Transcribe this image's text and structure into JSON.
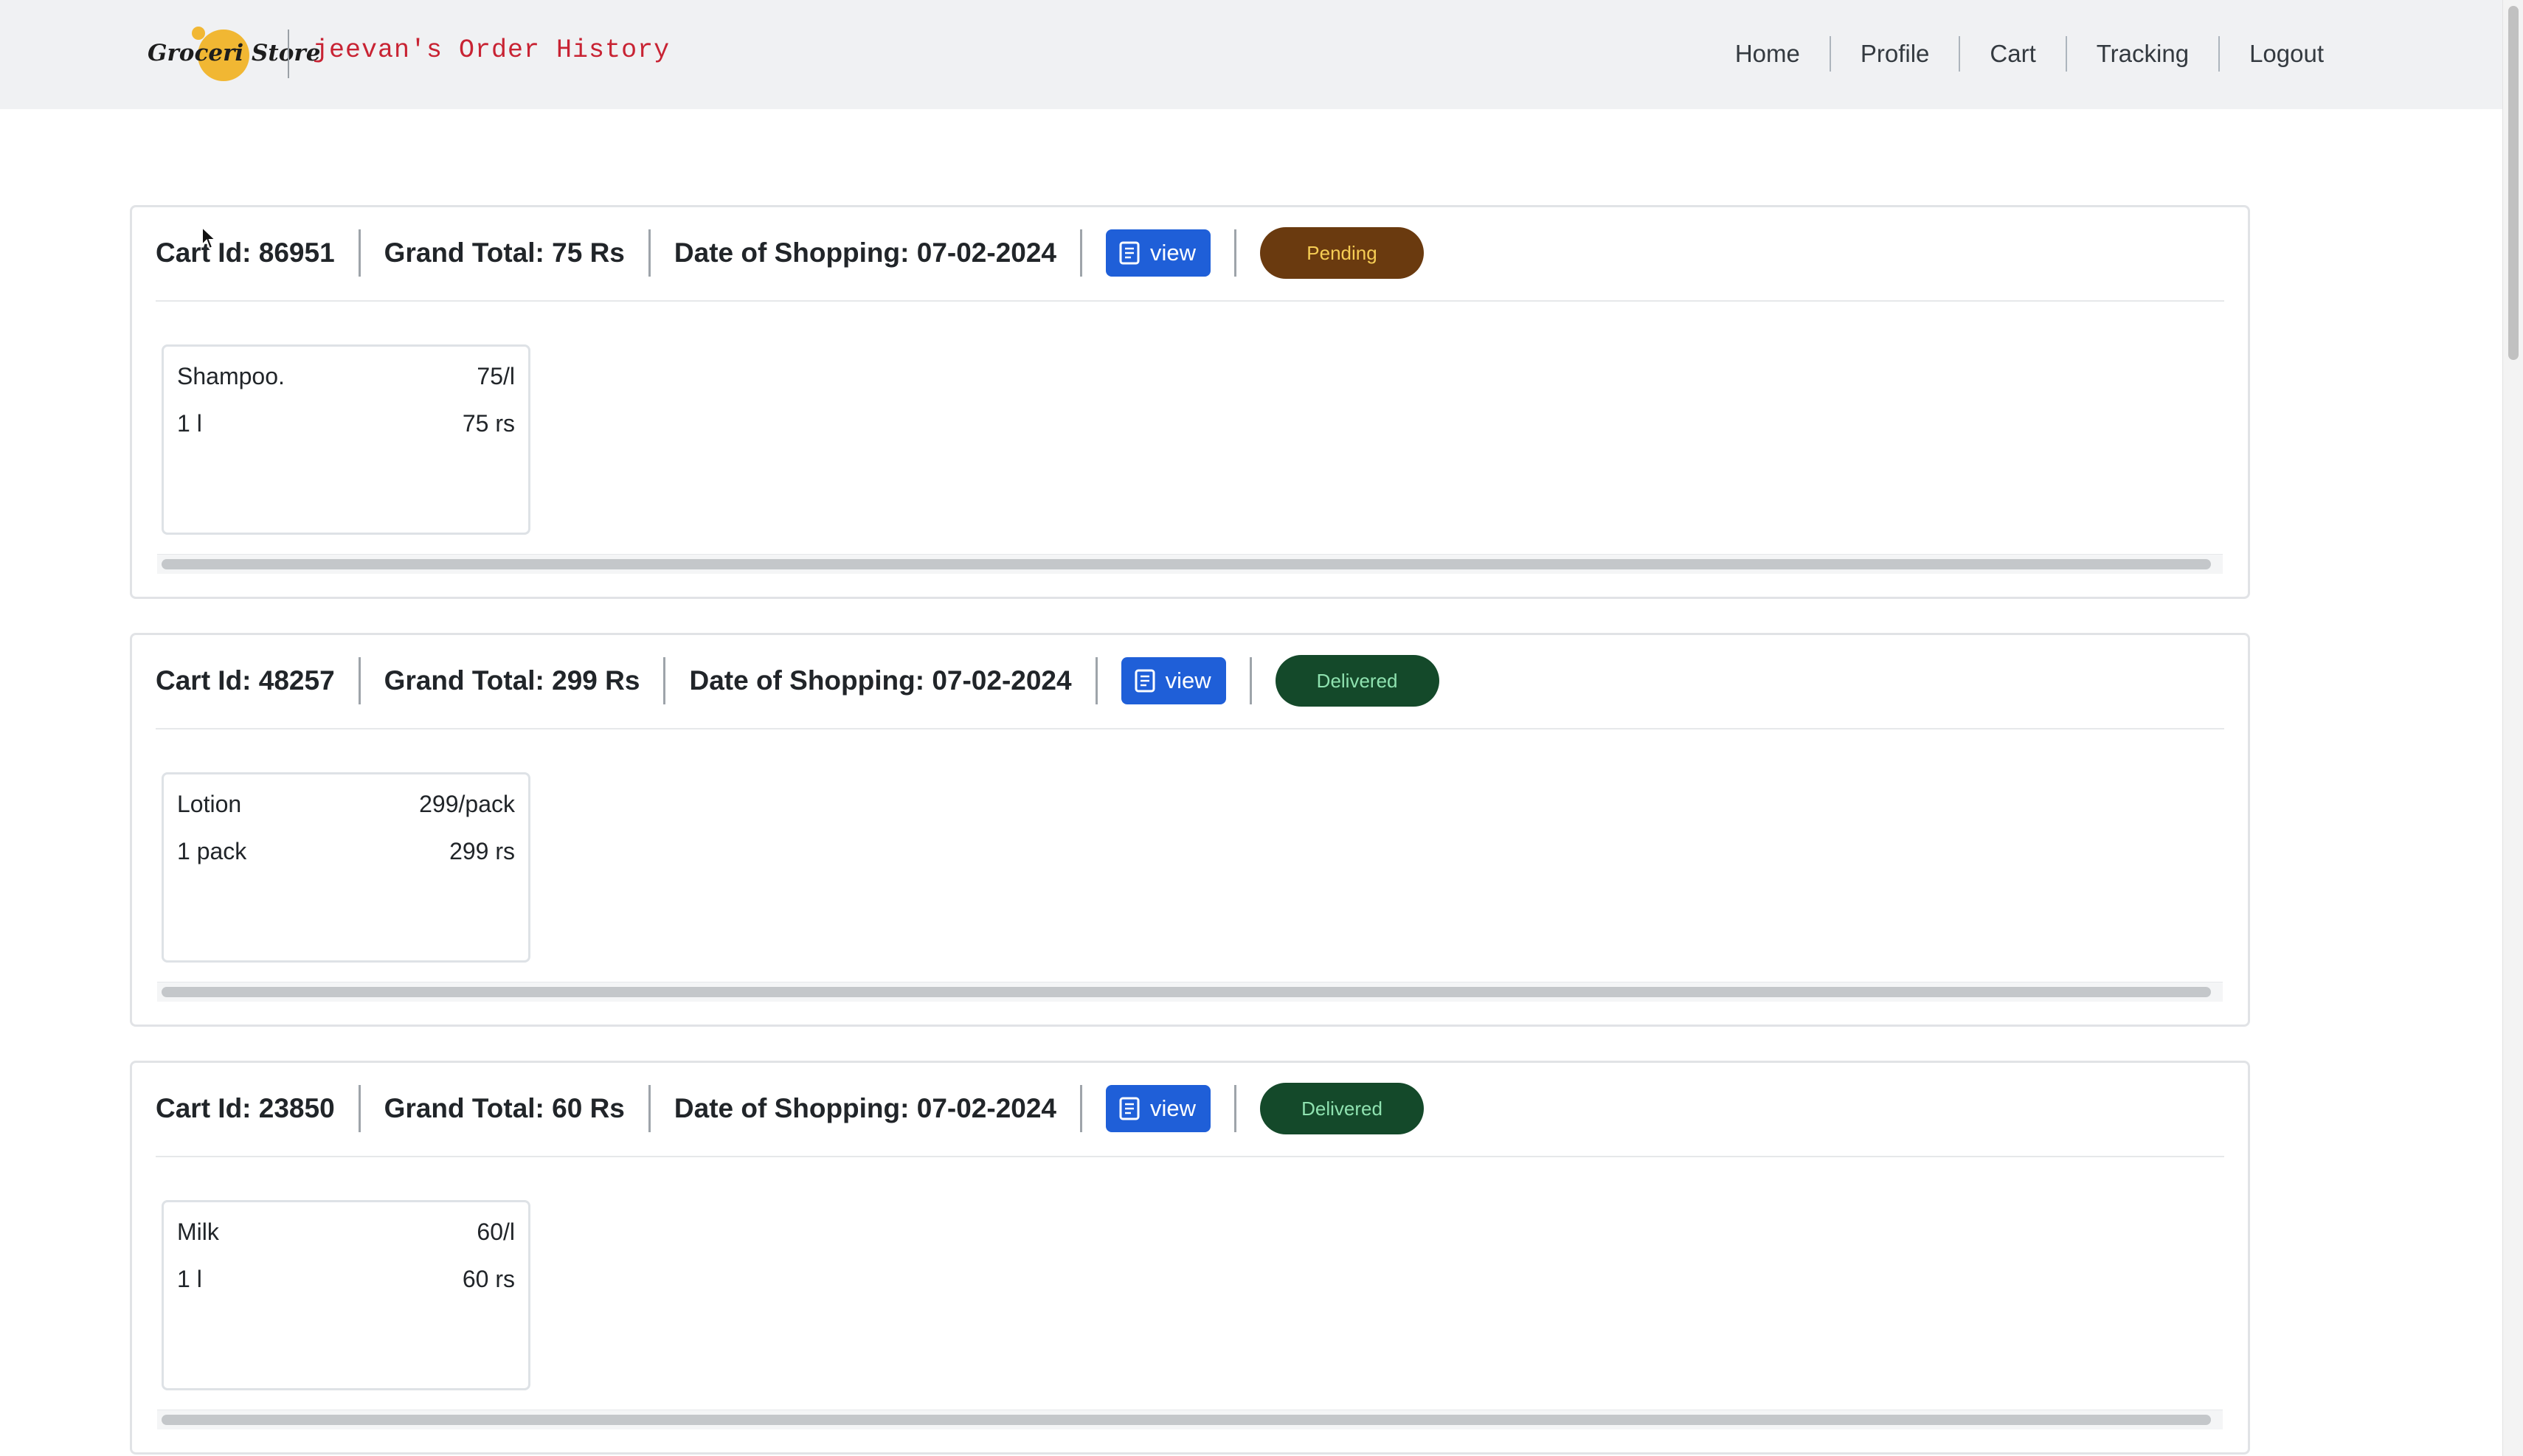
{
  "navbar": {
    "logo_text": "Groceri Store",
    "title": "jeevan's Order History",
    "links": [
      "Home",
      "Profile",
      "Cart",
      "Tracking",
      "Logout"
    ]
  },
  "orders": [
    {
      "cart_id": "Cart Id: 86951",
      "grand_total": "Grand Total: 75 Rs",
      "date": "Date of Shopping: 07-02-2024",
      "view_label": "view",
      "status": "Pending",
      "items": [
        {
          "name": "Shampoo.",
          "rate": "75/l",
          "quantity": "1 l",
          "price": "75 rs"
        }
      ]
    },
    {
      "cart_id": "Cart Id: 48257",
      "grand_total": "Grand Total: 299 Rs",
      "date": "Date of Shopping: 07-02-2024",
      "view_label": "view",
      "status": "Delivered",
      "items": [
        {
          "name": "Lotion",
          "rate": "299/pack",
          "quantity": "1 pack",
          "price": "299 rs"
        }
      ]
    },
    {
      "cart_id": "Cart Id: 23850",
      "grand_total": "Grand Total: 60 Rs",
      "date": "Date of Shopping: 07-02-2024",
      "view_label": "view",
      "status": "Delivered",
      "items": [
        {
          "name": "Milk",
          "rate": "60/l",
          "quantity": "1 l",
          "price": "60 rs"
        }
      ]
    }
  ],
  "colors": {
    "navbar_bg": "#f0f1f3",
    "title_red": "#c82333",
    "view_button_blue": "#1f5fd8",
    "pending_bg": "#6a3a0f",
    "pending_text": "#f6cd54",
    "delivered_bg": "#14492a",
    "delivered_text": "#8fe2b0",
    "logo_yellow": "#f1b733"
  },
  "icons": {
    "view_button": "document-icon",
    "cursor": "mouse-pointer-icon"
  }
}
